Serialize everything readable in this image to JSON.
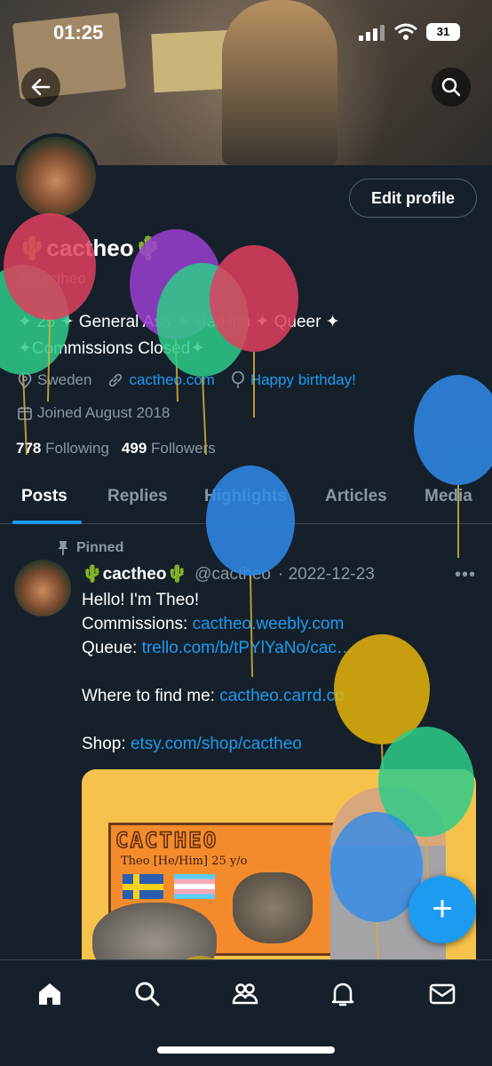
{
  "status_bar": {
    "time": "01:25",
    "battery": "31"
  },
  "profile": {
    "edit_button": "Edit profile",
    "name": "cactheo",
    "name_emoji": "🌵",
    "handle": "@cactheo",
    "bio_line1": "✦ 25 ✦ General Ass ✦ He/Him ✦ Queer ✦",
    "bio_line2": "✦Commissions Closed✦",
    "location": "Sweden",
    "website": "cactheo.com",
    "birthday": "Happy birthday!",
    "joined": "Joined August 2018",
    "following_count": "778",
    "following_label": "Following",
    "followers_count": "499",
    "followers_label": "Followers"
  },
  "tabs": [
    {
      "label": "Posts"
    },
    {
      "label": "Replies"
    },
    {
      "label": "Highlights"
    },
    {
      "label": "Articles"
    },
    {
      "label": "Media"
    }
  ],
  "tweet": {
    "pinned_label": "Pinned",
    "name": "🌵cactheo🌵",
    "handle": "@cactheo",
    "date": "· 2022-12-23",
    "line1": "Hello! I'm Theo!",
    "line2_prefix": "Commissions: ",
    "line2_link": "cactheo.weebly.com",
    "line3_prefix": "Queue: ",
    "line3_link": "trello.com/b/tPYlYaNo/cac…",
    "line4_prefix": "Where to find me: ",
    "line4_link": "cactheo.carrd.co",
    "line5_prefix": "Shop: ",
    "line5_link": "etsy.com/shop/cactheo",
    "media_logo": "CACTHEO",
    "media_sub": "Theo [He/Him] 25 y/o"
  },
  "fab_label": "+",
  "colors": {
    "background": "#15202b",
    "accent": "#1d9bf0",
    "muted": "#8b98a5"
  },
  "icons": {
    "back": "back-arrow-icon",
    "search": "search-icon",
    "location": "location-icon",
    "link": "link-icon",
    "birthday": "balloon-icon",
    "calendar": "calendar-icon",
    "pin": "pin-icon",
    "more": "more-icon",
    "nav": [
      "home-icon",
      "search-icon",
      "communities-icon",
      "notifications-icon",
      "messages-icon"
    ]
  }
}
